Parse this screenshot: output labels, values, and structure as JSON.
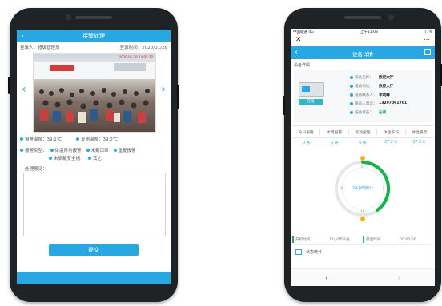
{
  "left_phone": {
    "header_title": "接警处理",
    "back_icon": "back-arrow-icon",
    "meta": {
      "handler_label": "登录人：超级管理员",
      "time_label": "登录时间：2020/01/26"
    },
    "photo_timestamp": "2020-01-26 14:05:22",
    "readings": {
      "temp1": "报警温度：39.1℃",
      "temp2": "复测温度：39.0℃"
    },
    "type_label": "报警类型：",
    "options": [
      "体温异常报警",
      "未戴口罩",
      "未佩戴安全帽",
      "重复报警",
      "其它"
    ],
    "note_label": "处理意见：",
    "submit_label": "提交",
    "accent_color": "#27a8e3"
  },
  "right_phone": {
    "status_bar": {
      "carrier": "中国联通 4G",
      "time": "上午11:08",
      "battery": "77%"
    },
    "close_icon": "close-icon",
    "more_icon": "more-icon",
    "header_title": "设备详情",
    "section_title": "设备详情",
    "device_badge": "在线",
    "fields": [
      {
        "label": "设备名称：",
        "value": "数控大厅"
      },
      {
        "label": "设备地址：",
        "value": "数控大厅"
      },
      {
        "label": "设备联系人：",
        "value": "李晓峰"
      },
      {
        "label": "联系人电话：",
        "value": "13297061701"
      },
      {
        "label": "设备状态：",
        "value": "在线"
      }
    ],
    "stats_headers": [
      "今日报警",
      "本周报警",
      "有效报警",
      "体温平均",
      "体温最高"
    ],
    "stats_values": [
      "0 条",
      "0 条",
      "0 条",
      "37.2℃",
      "37.5℃"
    ],
    "gauge_label": "24小时统计",
    "gauge_ticks": [
      "0",
      "6",
      "12",
      "18"
    ],
    "tabs": [
      "开机时间",
      "11小时52分",
      "最后时间",
      "00:00:00"
    ],
    "footer_link": "状态统计",
    "nav_back": "‹",
    "nav_forward": "›",
    "accent_color": "#27a8e3",
    "ring_color": "#18b34a"
  }
}
